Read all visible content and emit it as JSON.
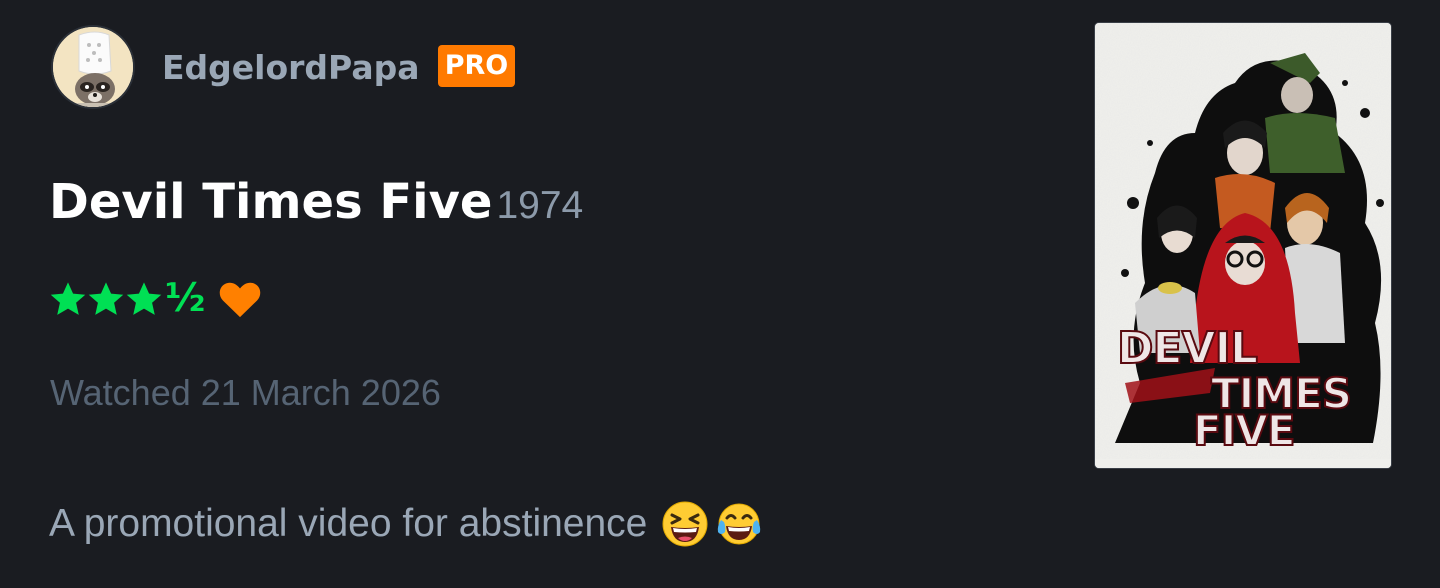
{
  "user": {
    "name": "EdgelordPapa",
    "badge": "PRO",
    "avatar_icon": "avatar-icon"
  },
  "film": {
    "title": "Devil Times Five",
    "year": "1974",
    "poster_text_lines": [
      "DEVIL",
      "TIMES",
      "FIVE"
    ]
  },
  "rating": {
    "stars": 3.5,
    "half_glyph": "½",
    "liked": true
  },
  "watched": {
    "label": "Watched 21 March 2026"
  },
  "review": {
    "text": "A promotional video for abstinence",
    "emojis": [
      "grinning-squinting-face",
      "face-with-tears-of-joy"
    ]
  },
  "colors": {
    "background": "#1a1c21",
    "pro_badge": "#ff7a00",
    "star": "#00e054",
    "heart": "#ff8000"
  }
}
